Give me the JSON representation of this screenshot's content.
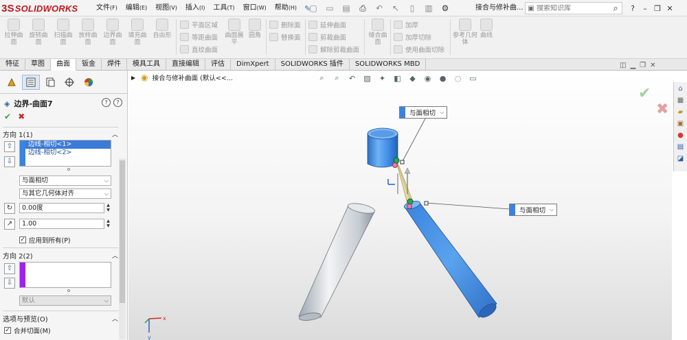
{
  "app": {
    "logo_ds": "3S",
    "logo_name": "SOLIDWORKS",
    "doc_title": "接合与修补曲..."
  },
  "menu": [
    {
      "label": "文件",
      "acc": "(F)"
    },
    {
      "label": "编辑",
      "acc": "(E)"
    },
    {
      "label": "视图",
      "acc": "(V)"
    },
    {
      "label": "插入",
      "acc": "(I)"
    },
    {
      "label": "工具",
      "acc": "(T)"
    },
    {
      "label": "窗口",
      "acc": "(W)"
    },
    {
      "label": "帮助",
      "acc": "(H)"
    }
  ],
  "search": {
    "placeholder": "搜索知识库"
  },
  "ribbon": {
    "big": [
      "拉伸曲面",
      "旋转曲面",
      "扫描曲面",
      "放样曲面",
      "边界曲面",
      "填充曲面",
      "自由形"
    ],
    "group2": [
      "平面区域",
      "等距曲面",
      "直纹曲面"
    ],
    "group2b": "曲面展平",
    "group2c": "圆角",
    "group3": [
      "删除面",
      "替换面"
    ],
    "group4": [
      "延伸曲面",
      "剪裁曲面",
      "解除剪裁曲面"
    ],
    "group5": "缝合曲面",
    "group6": [
      "加厚",
      "加厚切除",
      "使用曲面切除"
    ],
    "group7a": "参考几何体",
    "group7b": "曲线"
  },
  "tabs": [
    "特征",
    "草图",
    "曲面",
    "钣金",
    "焊件",
    "模具工具",
    "直接编辑",
    "评估",
    "DimXpert",
    "SOLIDWORKS 插件",
    "SOLIDWORKS MBD"
  ],
  "active_tab": "曲面",
  "panel": {
    "title": "边界-曲面7",
    "dir1": {
      "heading": "方向 1(1)",
      "items": [
        "边线-相切<1>",
        "边线-相切<2>"
      ],
      "tangency": "与面相切",
      "alignment": "与其它几何体对齐",
      "angle": "0.00度",
      "length": "1.00",
      "apply_all": "应用到所有(P)"
    },
    "dir2": {
      "heading": "方向 2(2)",
      "option": "默认"
    },
    "options": {
      "heading": "选项与预览(O)",
      "merge": "合并切面(M)"
    }
  },
  "viewport": {
    "crumb": "接合与修补曲面  (默认<<...",
    "callout1": "与面相切",
    "callout2": "与面相切",
    "triad_x": "x",
    "triad_y": "y"
  },
  "colors": {
    "surface_blue": "#3d8be6",
    "accent": "#3b7ad8",
    "logo_red": "#c3161c",
    "dir2_purple": "#a020f0"
  }
}
